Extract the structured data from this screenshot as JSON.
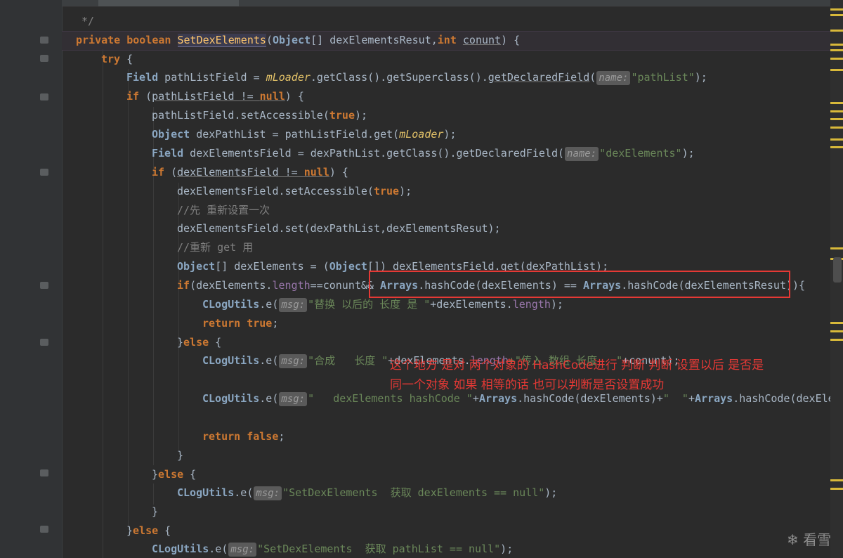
{
  "code": {
    "comment_end": "*/",
    "signature": {
      "private": "private",
      "boolean": "boolean",
      "method": "SetDexElements",
      "open": "(",
      "object": "Object",
      "arr": "[] dexElementsResut,",
      "int": "int",
      "p2": "conunt",
      "close": ")",
      "brace": " {"
    },
    "try": "try",
    "try_brace": " {",
    "l3": {
      "type": "Field",
      "v1": " pathListField = ",
      "mLoader": "mLoader",
      "v2": ".getClass().getSuperclass().",
      "getDeclared": "getDeclaredField",
      "open": "(",
      "hint": "name:",
      "str": "\"pathList\"",
      "end": ");"
    },
    "l4": {
      "if": "if",
      "open": " (",
      "cond": "pathListField != ",
      "null": "null",
      "close": ") {"
    },
    "l5": {
      "v1": "pathListField.setAccessible(",
      "true": "true",
      "end": ");"
    },
    "l6": {
      "type": "Object",
      "v1": " dexPathList = pathListField.get(",
      "mLoader": "mLoader",
      "end": ");"
    },
    "l7": {
      "type": "Field",
      "v1": " dexElementsField = dexPathList.getClass().getDeclaredField(",
      "hint": "name:",
      "str": "\"dexElements\"",
      "end": ");"
    },
    "l8": {
      "if": "if",
      "open": " (",
      "cond": "dexElementsField != ",
      "null": "null",
      "close": ") {"
    },
    "l9": {
      "v1": "dexElementsField.setAccessible(",
      "true": "true",
      "end": ");"
    },
    "l10": "//先 重新设置一次",
    "l11": "dexElementsField.set(dexPathList,dexElementsResut);",
    "l12": "//重新 get 用",
    "l13": {
      "type": "Object",
      "v1": "[] dexElements = (",
      "type2": "Object",
      "v2": "[]) dexElementsField.get(dexPathList);"
    },
    "l14": {
      "if": "if",
      "v1": "(dexElements.",
      "length": "length",
      "v2": "==conunt&& ",
      "arrays": "Arrays",
      "v3": ".hashCode(dexElements) == ",
      "arrays2": "Arrays",
      "v4": ".hashCode(dexElementsResut)){"
    },
    "l15": {
      "cls": "CLogUtils",
      "v1": ".e(",
      "hint": "msg:",
      "str": "\"替换 以后的 长度 是 \"",
      "v2": "+dexElements.",
      "length": "length",
      "end": ");"
    },
    "l16": {
      "return": "return",
      "true": "true",
      "end": ";"
    },
    "l17": {
      "close": "}",
      "else": "else",
      "brace": " {"
    },
    "l18": {
      "cls": "CLogUtils",
      "v1": ".e(",
      "hint": "msg:",
      "str": "\"合成   长度 \"",
      "v2": "+dexElements.",
      "length": "length",
      "str2": "+\"传入 数组 长度   \"",
      "v3": "+conunt);"
    },
    "l20": {
      "cls": "CLogUtils",
      "v1": ".e(",
      "hint": "msg:",
      "str": "\"   dexElements hashCode \"",
      "v2": "+",
      "arrays": "Arrays",
      "v3": ".hashCode(dexElements)+",
      "str2": "\"  \"",
      "v4": "+",
      "arrays2": "Arrays",
      "v5": ".hashCode(dexEleme"
    },
    "l22": {
      "return": "return",
      "false": "false",
      "end": ";"
    },
    "l23": "}",
    "l24": {
      "close": "}",
      "else": "else",
      "brace": " {"
    },
    "l25": {
      "cls": "CLogUtils",
      "v1": ".e(",
      "hint": "msg:",
      "str": "\"SetDexElements  获取 dexElements == null\"",
      "end": ");"
    },
    "l26": "}",
    "l27": {
      "close": "}",
      "else": "else",
      "brace": " {"
    },
    "l28": {
      "cls": "CLogUtils",
      "v1": ".e(",
      "hint": "msg:",
      "str": "\"SetDexElements  获取 pathList == null\"",
      "end": ");"
    }
  },
  "annotation": {
    "line1": "这个地方 是对 两个对象的 HashCode进行 判断 判断 设置以后 是否是",
    "line2": "同一个对象 如果 相等的话 也可以判断是否设置成功"
  },
  "watermark": "❄ 看雪",
  "colors": {
    "keyword": "#cc7832",
    "string": "#6a8759",
    "annotation": "#e53935",
    "method_highlight": "#ffc66d"
  }
}
